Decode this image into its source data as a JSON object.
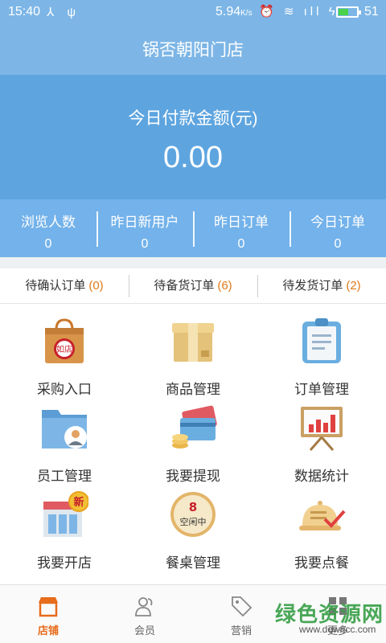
{
  "status_bar": {
    "time": "15:40",
    "left_icons": "⅄ ψ",
    "speed": "5.94",
    "speed_unit": "K/s",
    "right_icons": "⏰ ≋ ıll ϟ",
    "battery_level": "51"
  },
  "header": {
    "title": "锅否朝阳门店"
  },
  "summary": {
    "label": "今日付款金额(元)",
    "amount": "0.00"
  },
  "stats": [
    {
      "label": "浏览人数",
      "value": "0"
    },
    {
      "label": "昨日新用户",
      "value": "0"
    },
    {
      "label": "昨日订单",
      "value": "0"
    },
    {
      "label": "今日订单",
      "value": "0"
    }
  ],
  "pending": [
    {
      "label": "待确认订单",
      "count": "(0)"
    },
    {
      "label": "待备货订单",
      "count": "(6)"
    },
    {
      "label": "待发货订单",
      "count": "(2)"
    }
  ],
  "menu": [
    {
      "label": "采购入口",
      "icon": "shopping-bag-icon",
      "badge": "如店"
    },
    {
      "label": "商品管理",
      "icon": "box-icon"
    },
    {
      "label": "订单管理",
      "icon": "clipboard-icon"
    },
    {
      "label": "员工管理",
      "icon": "folder-user-icon"
    },
    {
      "label": "我要提现",
      "icon": "card-coins-icon"
    },
    {
      "label": "数据统计",
      "icon": "chart-board-icon"
    },
    {
      "label": "我要开店",
      "icon": "store-new-icon",
      "badge": "新"
    },
    {
      "label": "餐桌管理",
      "icon": "table-clock-icon",
      "badge_top": "8",
      "badge_bottom": "空闲中"
    },
    {
      "label": "我要点餐",
      "icon": "dish-cover-icon"
    }
  ],
  "tabs": [
    {
      "label": "店铺",
      "icon": "store-icon",
      "active": true
    },
    {
      "label": "会员",
      "icon": "members-icon"
    },
    {
      "label": "营销",
      "icon": "tag-icon"
    },
    {
      "label": "更多",
      "icon": "grid-icon"
    }
  ],
  "watermark": {
    "text": "绿色资源网",
    "sub": "www.downcc.com"
  },
  "colors": {
    "header": "#7db6e6",
    "panel": "#5ea5e0",
    "stats": "#73b2ea",
    "accent": "#e76c1b",
    "count": "#e07a1a"
  }
}
